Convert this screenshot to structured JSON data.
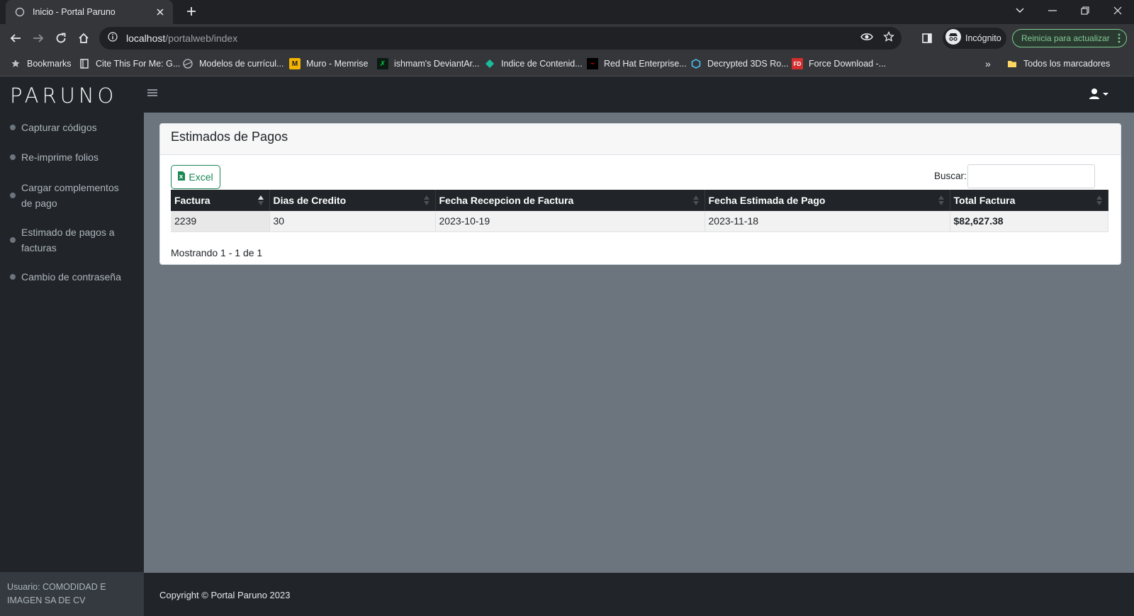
{
  "browser": {
    "tab_title": "Inicio - Portal Paruno",
    "url_host": "localhost",
    "url_path": "/portalweb/index",
    "incognito_label": "Incógnito",
    "update_label": "Reinicia para actualizar",
    "bookmarks": [
      {
        "label": "Bookmarks",
        "icon": "star-icon"
      },
      {
        "label": "Cite This For Me: G...",
        "icon": "book-icon"
      },
      {
        "label": "Modelos de currícul...",
        "icon": "globe-icon"
      },
      {
        "label": "Muro - Memrise",
        "icon": "memrise-icon"
      },
      {
        "label": "ishmam's DeviantAr...",
        "icon": "deviantart-icon"
      },
      {
        "label": "Indice de Contenid...",
        "icon": "diamond-icon"
      },
      {
        "label": "Red Hat Enterprise...",
        "icon": "redhat-icon"
      },
      {
        "label": "Decrypted 3DS Ro...",
        "icon": "hexagon-icon"
      },
      {
        "label": "Force Download -...",
        "icon": "fd-icon"
      }
    ],
    "more_bookmarks": "»",
    "all_bookmarks": "Todos los marcadores"
  },
  "app": {
    "logo": "PARUNO",
    "sidebar": {
      "items": [
        {
          "label": "Capturar códigos"
        },
        {
          "label": "Re-imprime folios"
        },
        {
          "label": "Cargar complementos de pago"
        },
        {
          "label": "Estimado de pagos a facturas"
        },
        {
          "label": "Cambio de contraseña"
        }
      ],
      "user": "Usuario: COMODIDAD E IMAGEN SA DE CV"
    },
    "card": {
      "title": "Estimados de Pagos",
      "excel_label": "Excel",
      "search_label": "Buscar:",
      "search_value": "",
      "columns": [
        "Factura",
        "Dias de Credito",
        "Fecha Recepcion de Factura",
        "Fecha Estimada de Pago",
        "Total Factura"
      ],
      "rows": [
        [
          "2239",
          "30",
          "2023-10-19",
          "2023-11-18",
          "$82,627.38"
        ]
      ],
      "info": "Mostrando 1 - 1 de 1"
    },
    "footer": "Copyright © Portal Paruno 2023"
  },
  "colors": {
    "navbar": "#212529",
    "content_bg": "#6c757d",
    "excel_green": "#198754",
    "update_green": "#81c995"
  }
}
